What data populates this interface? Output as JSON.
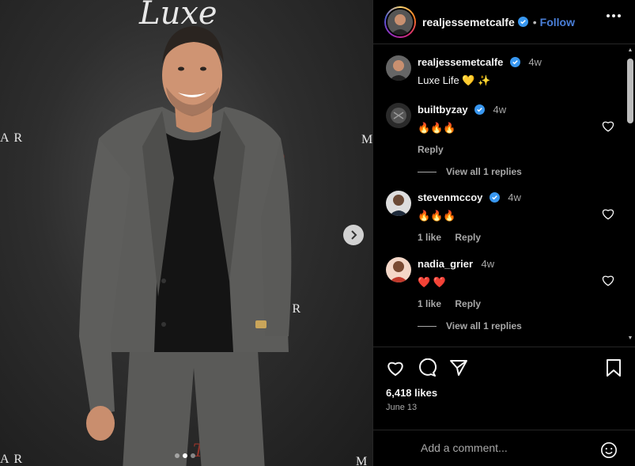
{
  "post": {
    "username": "realjessemetcalfe",
    "follow_label": "Follow",
    "separator": "•",
    "likes": "6,418 likes",
    "date": "June 13",
    "comment_placeholder": "Add a comment..."
  },
  "media": {
    "backdrop_top": "Luxe",
    "backdrop_left": "AR",
    "backdrop_right": "M",
    "backdrop_mid": "AR",
    "backdrop_bottom_left": "AR",
    "backdrop_bottom_right": "M",
    "backdrop_bottom_center": "The",
    "carousel_count": 3,
    "carousel_active": 2
  },
  "caption": {
    "username": "realjessemetcalfe",
    "time": "4w",
    "text": "Luxe Life 💛 ✨"
  },
  "comments": [
    {
      "username": "builtbyzay",
      "verified": true,
      "time": "4w",
      "text": "🔥🔥🔥",
      "likes": "",
      "reply": "Reply",
      "view_replies": "View all 1 replies"
    },
    {
      "username": "stevenmccoy",
      "verified": true,
      "time": "4w",
      "text": "🔥🔥🔥",
      "likes": "1 like",
      "reply": "Reply",
      "view_replies": ""
    },
    {
      "username": "nadia_grier",
      "verified": false,
      "time": "4w",
      "text": "❤️ ❤️",
      "likes": "1 like",
      "reply": "Reply",
      "view_replies": "View all 1 replies"
    }
  ],
  "colors": {
    "accent": "#4a7fd8",
    "verified": "#3897f0",
    "muted": "#a8a8a8",
    "bg": "#000000"
  }
}
